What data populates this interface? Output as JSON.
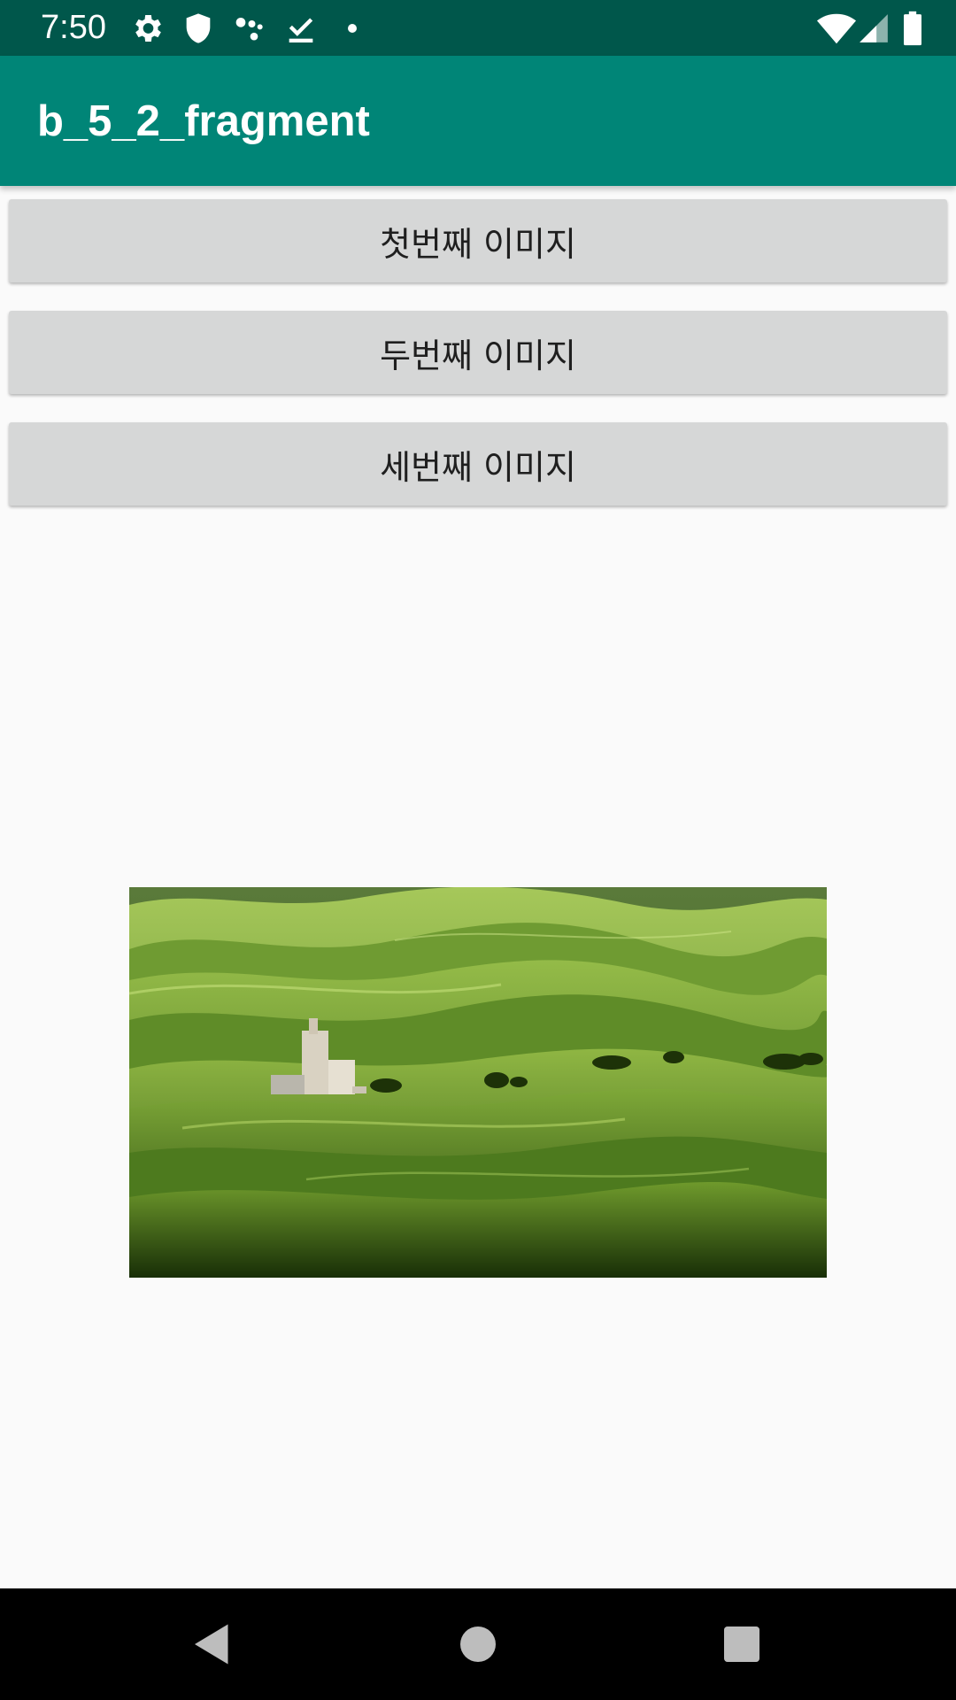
{
  "status_bar": {
    "time": "7:50",
    "icons_left": [
      "gear-icon",
      "shield-icon",
      "assistant-dots-icon",
      "download-done-icon",
      "notification-dot-icon"
    ],
    "icons_right": [
      "wifi-icon",
      "cell-signal-icon",
      "battery-icon"
    ],
    "color": "#00574b"
  },
  "app_bar": {
    "title": "b_5_2_fragment",
    "color": "#008577"
  },
  "buttons": [
    {
      "label": "첫번째 이미지"
    },
    {
      "label": "두번째 이미지"
    },
    {
      "label": "세번째 이미지"
    }
  ],
  "main_image": {
    "subject": "rolling-green-hills-landscape"
  },
  "nav_bar": {
    "icons": [
      "back-icon",
      "home-icon",
      "recents-icon"
    ]
  }
}
